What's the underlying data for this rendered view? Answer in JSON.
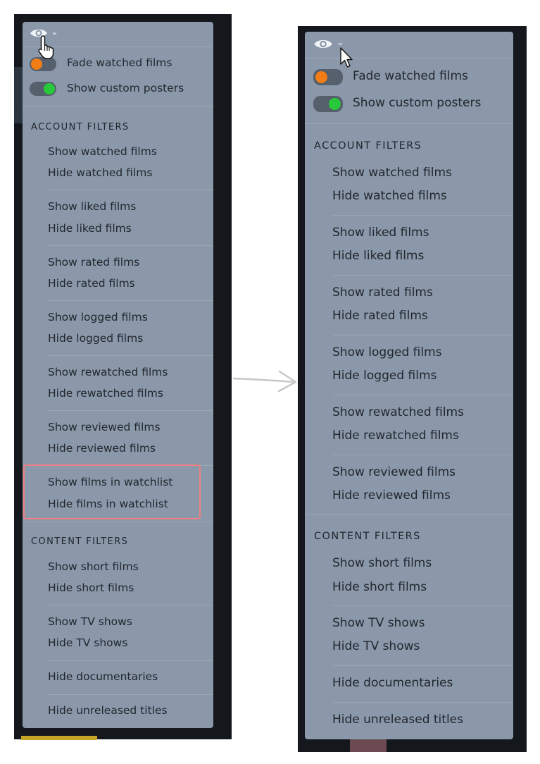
{
  "colors": {
    "page_bg": "#ffffff",
    "app_bg": "#14181c",
    "panel_bg": "#8a98aa",
    "panel_text": "#22272e",
    "divider": "#9aa7b6",
    "toggle_track": "#56606c",
    "toggle_orange": "#f27c15",
    "toggle_green": "#27c83a",
    "highlight_border": "#ee7f82",
    "arrow": "#c8c8c8"
  },
  "icons": {
    "eye": "eye-icon",
    "chevron": "chevron-down-icon",
    "hand_cursor": "hand-pointer-cursor-icon",
    "arrow_cursor": "arrow-pointer-cursor-icon",
    "arrow": "right-arrow-icon"
  },
  "before": {
    "chevron": "⌄",
    "toggles": [
      {
        "label": "Fade watched films",
        "state": "on",
        "color": "orange"
      },
      {
        "label": "Show custom posters",
        "state": "on",
        "color": "green"
      }
    ],
    "account_header": "ACCOUNT FILTERS",
    "account_groups": [
      [
        "Show watched films",
        "Hide watched films"
      ],
      [
        "Show liked films",
        "Hide liked films"
      ],
      [
        "Show rated films",
        "Hide rated films"
      ],
      [
        "Show logged films",
        "Hide logged films"
      ],
      [
        "Show rewatched films",
        "Hide rewatched films"
      ],
      [
        "Show reviewed films",
        "Hide reviewed films"
      ],
      [
        "Show films in watchlist",
        "Hide films in watchlist"
      ]
    ],
    "content_header": "CONTENT FILTERS",
    "content_groups": [
      [
        "Show short films",
        "Hide short films"
      ],
      [
        "Show TV shows",
        "Hide TV shows"
      ],
      [
        "Hide documentaries"
      ],
      [
        "Hide unreleased titles"
      ]
    ]
  },
  "after": {
    "chevron": "⌄",
    "toggles": [
      {
        "label": "Fade watched films",
        "state": "on",
        "color": "orange"
      },
      {
        "label": "Show custom posters",
        "state": "on",
        "color": "green"
      }
    ],
    "account_header": "ACCOUNT FILTERS",
    "account_groups": [
      [
        "Show watched films",
        "Hide watched films"
      ],
      [
        "Show liked films",
        "Hide liked films"
      ],
      [
        "Show rated films",
        "Hide rated films"
      ],
      [
        "Show logged films",
        "Hide logged films"
      ],
      [
        "Show rewatched films",
        "Hide rewatched films"
      ],
      [
        "Show reviewed films",
        "Hide reviewed films"
      ]
    ],
    "content_header": "CONTENT FILTERS",
    "content_groups": [
      [
        "Show short films",
        "Hide short films"
      ],
      [
        "Show TV shows",
        "Hide TV shows"
      ],
      [
        "Hide documentaries"
      ],
      [
        "Hide unreleased titles"
      ]
    ]
  }
}
